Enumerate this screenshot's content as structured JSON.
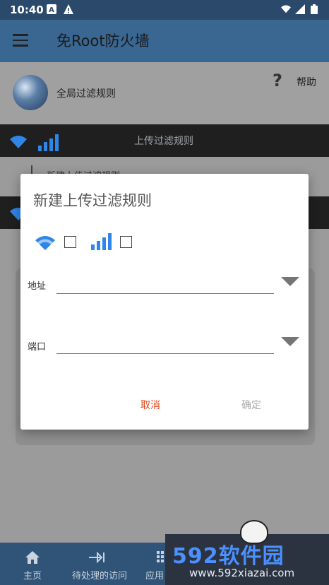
{
  "status_bar": {
    "time": "10:40"
  },
  "app_bar": {
    "title": "免Root防火墙"
  },
  "global_filter": {
    "label": "全局过滤规则"
  },
  "help": {
    "icon": "?",
    "label": "帮助"
  },
  "upload_section": {
    "title": "上传过滤规则",
    "item": "新建上传过滤规则"
  },
  "dialog": {
    "title": "新建上传过滤规则",
    "wifi_checked": false,
    "mobile_checked": false,
    "address_label": "地址",
    "address_value": "",
    "port_label": "端口",
    "port_value": "",
    "cancel_label": "取消",
    "ok_label": "确定"
  },
  "bottom_nav": [
    {
      "label": "主页",
      "icon": "home-icon"
    },
    {
      "label": "待处理的访问",
      "icon": "arrow-to-bar-icon"
    },
    {
      "label": "应用",
      "icon": "grid-icon"
    }
  ],
  "watermark": {
    "brand": "592软件园",
    "url": "www.592xiazai.com"
  },
  "colors": {
    "primary": "#3a6792",
    "accent_blue": "#2f86e8",
    "cancel": "#e0471a",
    "disabled": "#aaaaaa"
  }
}
